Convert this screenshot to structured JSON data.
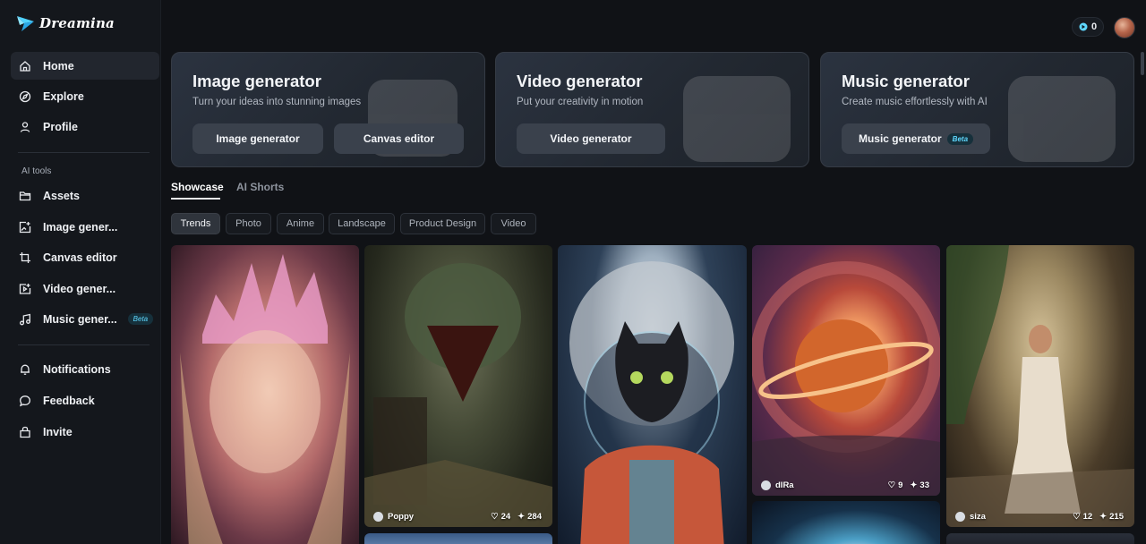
{
  "app": {
    "name": "Dreamina"
  },
  "header": {
    "credits": "0"
  },
  "sidebar": {
    "items": [
      {
        "label": "Home",
        "icon": "home-icon",
        "active": true
      },
      {
        "label": "Explore",
        "icon": "compass-icon"
      },
      {
        "label": "Profile",
        "icon": "user-icon"
      }
    ],
    "section_label": "AI tools",
    "tools": [
      {
        "label": "Assets",
        "icon": "folder-icon"
      },
      {
        "label": "Image gener...",
        "icon": "image-plus-icon"
      },
      {
        "label": "Canvas editor",
        "icon": "crop-icon"
      },
      {
        "label": "Video gener...",
        "icon": "video-plus-icon"
      },
      {
        "label": "Music gener...",
        "icon": "music-icon",
        "badge": "Beta"
      }
    ],
    "bottom": [
      {
        "label": "Notifications",
        "icon": "bell-icon"
      },
      {
        "label": "Feedback",
        "icon": "chat-icon"
      },
      {
        "label": "Invite",
        "icon": "gift-icon"
      }
    ]
  },
  "cards": [
    {
      "title": "Image generator",
      "subtitle": "Turn your ideas into stunning images",
      "buttons": [
        "Image generator",
        "Canvas editor"
      ]
    },
    {
      "title": "Video generator",
      "subtitle": "Put your creativity in motion",
      "buttons": [
        "Video generator"
      ]
    },
    {
      "title": "Music generator",
      "subtitle": "Create music effortlessly with AI",
      "buttons": [
        "Music generator"
      ],
      "badge": "Beta"
    }
  ],
  "tabs": [
    "Showcase",
    "AI Shorts"
  ],
  "chips": [
    "Trends",
    "Photo",
    "Anime",
    "Landscape",
    "Product Design",
    "Video"
  ],
  "gallery": [
    {
      "user": "Poppy",
      "likes": "24",
      "remixes": "284"
    },
    {
      "user": "dIRa",
      "likes": "9",
      "remixes": "33"
    },
    {
      "user": "siza",
      "likes": "12",
      "remixes": "215"
    }
  ],
  "colors": {
    "accent": "#5fd8ff",
    "background": "#101216",
    "sidebar": "#14171c"
  }
}
